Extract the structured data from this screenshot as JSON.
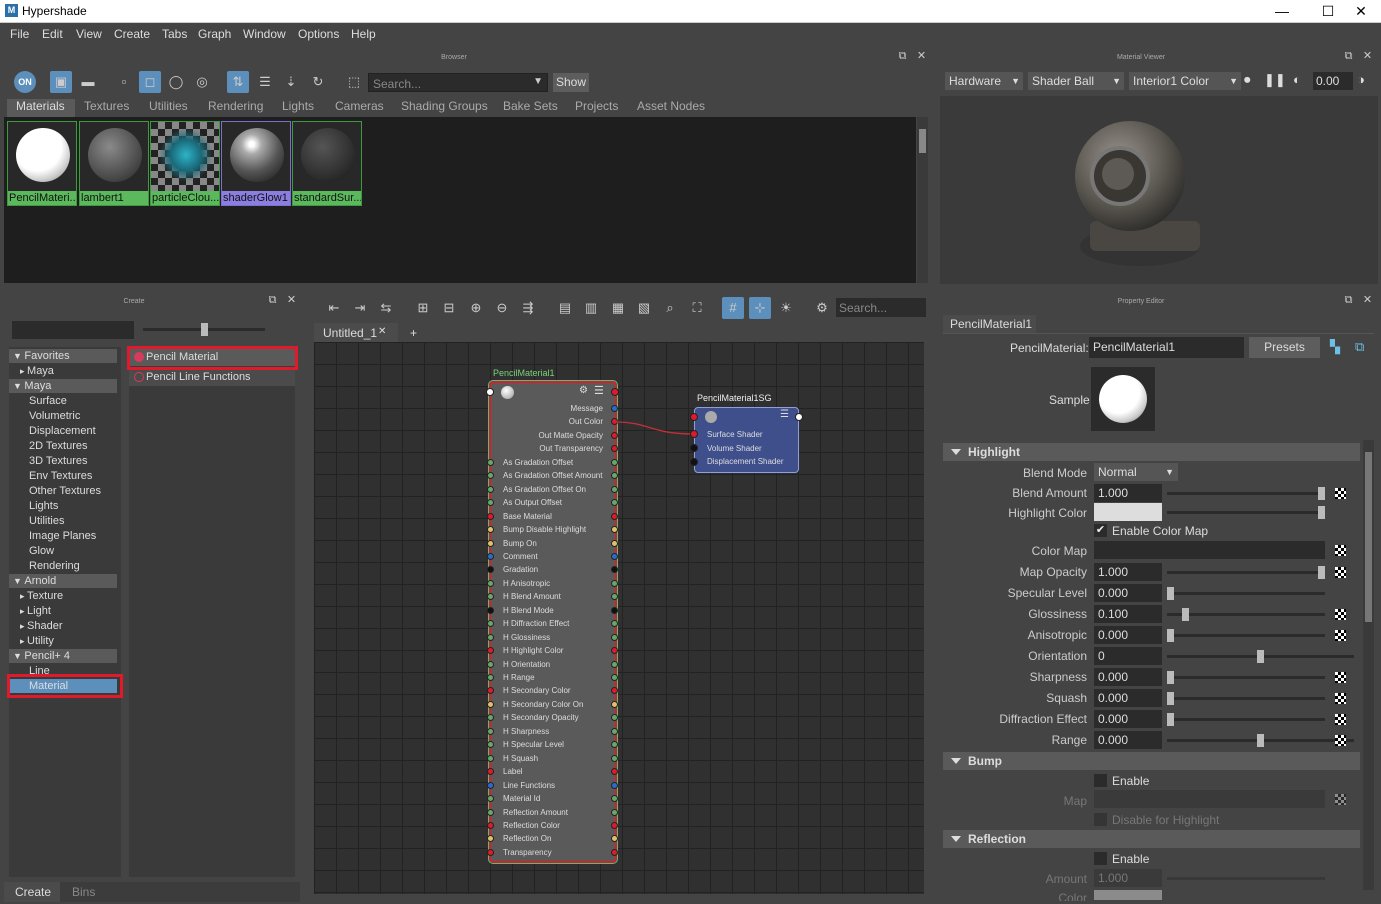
{
  "window": {
    "title": "Hypershade",
    "logo": "M",
    "minimize": "—",
    "maximize": "☐",
    "close": "✕"
  },
  "menu": [
    "File",
    "Edit",
    "View",
    "Create",
    "Tabs",
    "Graph",
    "Window",
    "Options",
    "Help"
  ],
  "browser": {
    "title": "Browser",
    "search_placeholder": "Search...",
    "show_label": "Show",
    "tabs": [
      "Materials",
      "Textures",
      "Utilities",
      "Rendering",
      "Lights",
      "Cameras",
      "Shading Groups",
      "Bake Sets",
      "Projects",
      "Asset Nodes"
    ],
    "swatches": [
      {
        "label": "PencilMateri...",
        "kind": "white"
      },
      {
        "label": "lambert1",
        "kind": "grey"
      },
      {
        "label": "particleClou...",
        "kind": "checker"
      },
      {
        "label": "shaderGlow1",
        "kind": "glow"
      },
      {
        "label": "standardSur...",
        "kind": "dark"
      }
    ]
  },
  "material_viewer": {
    "title": "Material Viewer",
    "renderer": "Hardware",
    "geometry": "Shader Ball",
    "environment": "Interior1 Color",
    "exposure": "0.00"
  },
  "create_panel": {
    "title": "Create",
    "tree": [
      {
        "label": "Favorites",
        "type": "hdr"
      },
      {
        "label": "Maya",
        "type": "sub"
      },
      {
        "label": "Maya",
        "type": "hdr"
      },
      {
        "label": "Surface",
        "type": "leaf"
      },
      {
        "label": "Volumetric",
        "type": "leaf"
      },
      {
        "label": "Displacement",
        "type": "leaf"
      },
      {
        "label": "2D Textures",
        "type": "leaf"
      },
      {
        "label": "3D Textures",
        "type": "leaf"
      },
      {
        "label": "Env Textures",
        "type": "leaf"
      },
      {
        "label": "Other Textures",
        "type": "leaf"
      },
      {
        "label": "Lights",
        "type": "leaf"
      },
      {
        "label": "Utilities",
        "type": "leaf"
      },
      {
        "label": "Image Planes",
        "type": "leaf"
      },
      {
        "label": "Glow",
        "type": "leaf"
      },
      {
        "label": "Rendering",
        "type": "leaf"
      },
      {
        "label": "Arnold",
        "type": "hdr"
      },
      {
        "label": "Texture",
        "type": "sub"
      },
      {
        "label": "Light",
        "type": "sub"
      },
      {
        "label": "Shader",
        "type": "sub"
      },
      {
        "label": "Utility",
        "type": "sub"
      },
      {
        "label": "Pencil+ 4",
        "type": "hdr"
      },
      {
        "label": "Line",
        "type": "leaf"
      },
      {
        "label": "Material",
        "type": "selected"
      }
    ],
    "items": [
      "Pencil Material",
      "Pencil Line Functions"
    ],
    "bottom_tabs": [
      "Create",
      "Bins"
    ]
  },
  "graph": {
    "search_placeholder": "Search...",
    "tab": "Untitled_1",
    "tab_close": "✕",
    "add_tab": "+",
    "node1": {
      "title": "PencilMaterial1",
      "rows": [
        "Message",
        "Out Color",
        "Out Matte Opacity",
        "Out Transparency",
        "As Gradation Offset",
        "As Gradation Offset Amount",
        "As Gradation Offset On",
        "As Output Offset",
        "Base Material",
        "Bump Disable Highlight",
        "Bump On",
        "Comment",
        "Gradation",
        "H Anisotropic",
        "H Blend Amount",
        "H Blend Mode",
        "H Diffraction Effect",
        "H Glossiness",
        "H Highlight Color",
        "H Orientation",
        "H Range",
        "H Secondary Color",
        "H Secondary Color On",
        "H Secondary Opacity",
        "H Sharpness",
        "H Specular Level",
        "H Squash",
        "Label",
        "Line Functions",
        "Material Id",
        "Reflection Amount",
        "Reflection Color",
        "Reflection On",
        "Transparency"
      ]
    },
    "node2": {
      "title": "PencilMaterial1SG",
      "rows": [
        "Surface Shader",
        "Volume Shader",
        "Displacement Shader"
      ]
    }
  },
  "property_editor": {
    "title": "Property Editor",
    "tab": "PencilMaterial1",
    "name_label": "PencilMaterial:",
    "name_value": "PencilMaterial1",
    "presets": "Presets",
    "sample_label": "Sample",
    "sections": {
      "highlight": "Highlight",
      "bump": "Bump",
      "reflection": "Reflection"
    },
    "blend_mode_label": "Blend Mode",
    "blend_mode_value": "Normal",
    "highlight_color_label": "Highlight Color",
    "enable_color_map": "Enable Color Map",
    "color_map_label": "Color Map",
    "fields": [
      {
        "label": "Blend Amount",
        "value": "1.000",
        "level": 1.0
      },
      {
        "label": "Map Opacity",
        "value": "1.000",
        "level": 1.0
      },
      {
        "label": "Specular Level",
        "value": "0.000",
        "level": 0.0
      },
      {
        "label": "Glossiness",
        "value": "0.100",
        "level": 0.1
      },
      {
        "label": "Anisotropic",
        "value": "0.000",
        "level": 0.0
      },
      {
        "label": "Orientation",
        "value": "0",
        "level": 0.5
      },
      {
        "label": "Sharpness",
        "value": "0.000",
        "level": 0.0
      },
      {
        "label": "Squash",
        "value": "0.000",
        "level": 0.0
      },
      {
        "label": "Diffraction Effect",
        "value": "0.000",
        "level": 0.0
      },
      {
        "label": "Range",
        "value": "0.000",
        "level": 0.5
      }
    ],
    "bump_enable": "Enable",
    "bump_map": "Map",
    "bump_disable_highlight": "Disable for Highlight",
    "refl_enable": "Enable",
    "refl_amount": "Amount",
    "refl_amount_value": "1.000",
    "refl_color": "Color"
  }
}
